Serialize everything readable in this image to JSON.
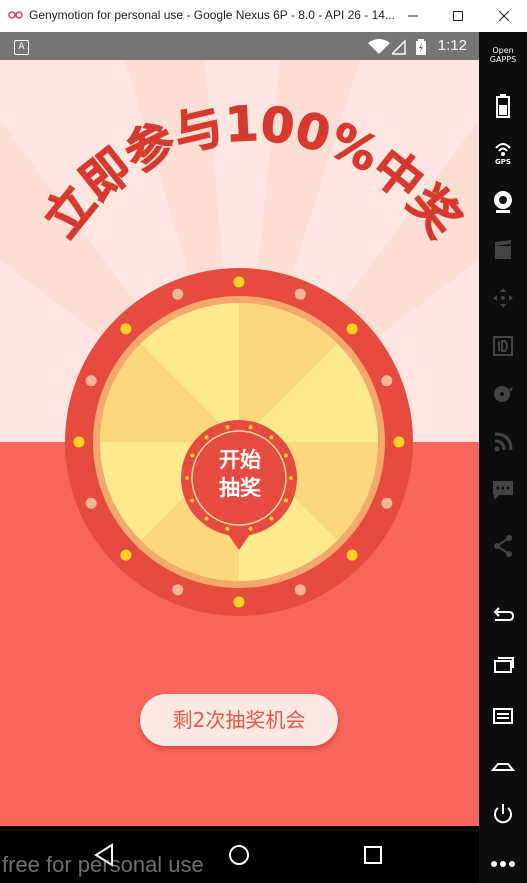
{
  "window": {
    "title": "Genymotion for personal use - Google Nexus 6P - 8.0 - API 26 - 14...",
    "watermark": "free for personal use"
  },
  "status_bar": {
    "time": "1:12",
    "notification_icon": "A"
  },
  "app": {
    "headline": "立即参与100%中奖",
    "start_button_line1": "开始",
    "start_button_line2": "抽奖",
    "chances_label": "剩2次抽奖机会",
    "colors": {
      "background_top": "#fde6df",
      "background_bottom": "#f8655a",
      "wheel_rim": "#e64b3f",
      "headline": "#d63a2f",
      "segment_light": "#ffe98f",
      "segment_dark": "#fcd77b"
    }
  },
  "sidebar": {
    "opengapps_line1": "Open",
    "opengapps_line2": "GAPPS",
    "gps_label": "GPS",
    "items": [
      "opengapps-icon",
      "battery-icon",
      "gps-icon",
      "webcam-icon",
      "capture-icon",
      "move-icon",
      "id-icon",
      "disk-icon",
      "rss-icon",
      "sms-icon",
      "share-icon",
      "back-icon",
      "recent-apps-icon",
      "menu-icon",
      "home-icon",
      "power-icon",
      "more-icon"
    ]
  },
  "navbar": {
    "icons": [
      "back-triangle-icon",
      "home-circle-icon",
      "recents-square-icon"
    ]
  }
}
